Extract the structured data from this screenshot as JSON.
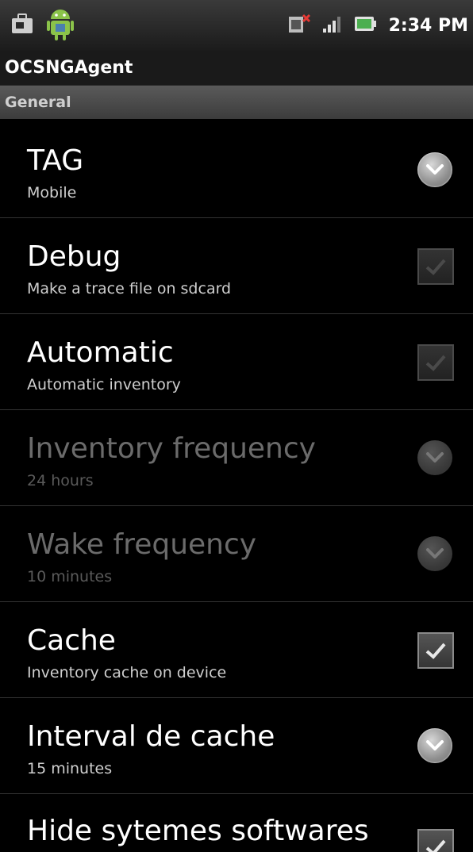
{
  "status_bar": {
    "left_icons": [
      "briefcase-icon",
      "android-icon"
    ],
    "right_icons": [
      "no-sim-icon",
      "signal-icon",
      "battery-icon"
    ],
    "time": "2:34 PM"
  },
  "title_bar": {
    "title": "OCSNGAgent"
  },
  "category": {
    "label": "General"
  },
  "preferences": [
    {
      "title": "TAG",
      "summary": "Mobile",
      "widget": "dropdown",
      "enabled": true
    },
    {
      "title": "Debug",
      "summary": "Make a trace file on sdcard",
      "widget": "checkbox",
      "checked": false,
      "enabled": true
    },
    {
      "title": "Automatic",
      "summary": "Automatic inventory",
      "widget": "checkbox",
      "checked": false,
      "enabled": true
    },
    {
      "title": "Inventory frequency",
      "summary": "24 hours",
      "widget": "dropdown",
      "enabled": false
    },
    {
      "title": "Wake frequency",
      "summary": "10 minutes",
      "widget": "dropdown",
      "enabled": false
    },
    {
      "title": "Cache",
      "summary": "Inventory cache on device",
      "widget": "checkbox",
      "checked": true,
      "enabled": true
    },
    {
      "title": "Interval de cache",
      "summary": "15 minutes",
      "widget": "dropdown",
      "enabled": true
    },
    {
      "title": "Hide sytemes softwares",
      "summary": "",
      "widget": "checkbox",
      "checked": true,
      "enabled": true
    }
  ],
  "colors": {
    "background": "#000000",
    "category_bg": "#4a4a4a",
    "title_text": "#ffffff",
    "summary_text": "#cfcfcf",
    "disabled_text": "#6b6b6b"
  }
}
